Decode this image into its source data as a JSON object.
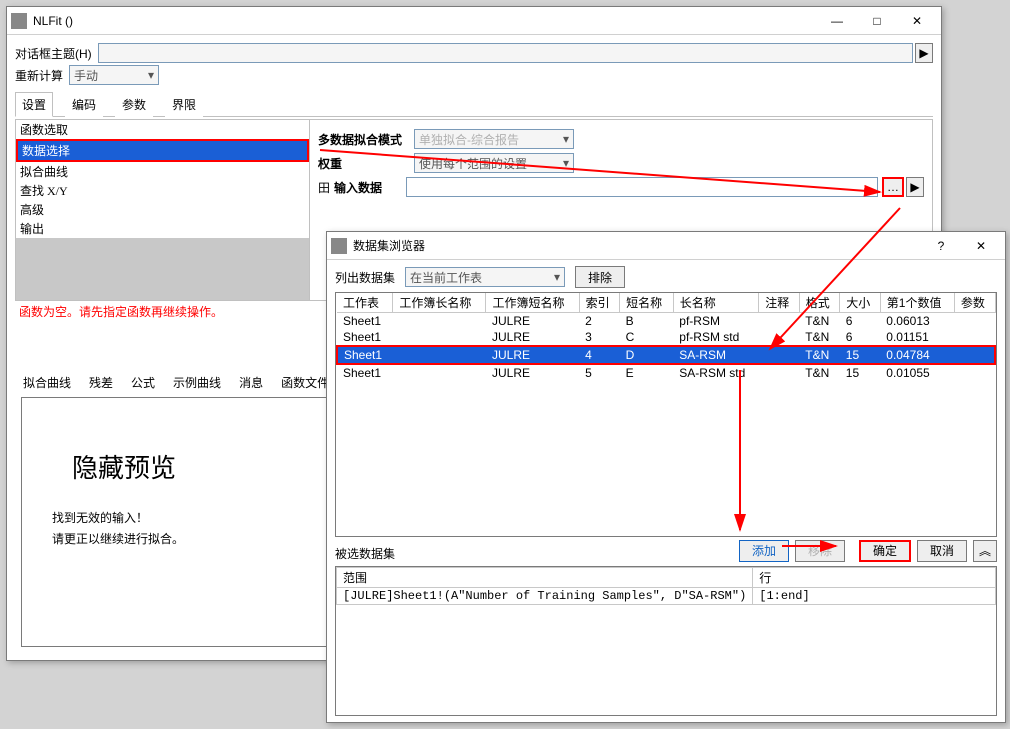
{
  "nlfit": {
    "title": "NLFit ()",
    "dialog_theme_label": "对话框主题(H)",
    "recalc_label": "重新计算",
    "recalc_value": "手动",
    "tabs": [
      "设置",
      "编码",
      "参数",
      "界限"
    ],
    "left_items": [
      "函数选取",
      "数据选择",
      "拟合曲线",
      "查找 X/Y",
      "高级",
      "输出"
    ],
    "left_selected": 1,
    "right": {
      "multi_mode_label": "多数据拟合模式",
      "multi_mode_value": "单独拟合-综合报告",
      "weight_label": "权重",
      "weight_value": "使用每个范围的设置",
      "input_expand_label": "田",
      "input_data_label": "输入数据",
      "dots_label": "…"
    },
    "warning": "函数为空。请先指定函数再继续操作。",
    "lower_tabs": [
      "拟合曲线",
      "残差",
      "公式",
      "示例曲线",
      "消息",
      "函数文件"
    ],
    "preview_title": "隐藏预览",
    "preview_msg_1": "找到无效的输入！",
    "preview_msg_2": "请更正以继续进行拟合。"
  },
  "dsb": {
    "title": "数据集浏览器",
    "help_icon": "?",
    "list_label": "列出数据集",
    "list_value": "在当前工作表",
    "exclude_btn": "排除",
    "columns": [
      "工作表",
      "工作簿长名称",
      "工作簿短名称",
      "索引",
      "短名称",
      "长名称",
      "注释",
      "格式",
      "大小",
      "第1个数值",
      "参数"
    ],
    "rows": [
      {
        "cells": [
          "Sheet1",
          "",
          "JULRE",
          "2",
          "B",
          "pf-RSM",
          "",
          "T&N",
          "6",
          "0.06013",
          ""
        ],
        "sel": false
      },
      {
        "cells": [
          "Sheet1",
          "",
          "JULRE",
          "3",
          "C",
          "pf-RSM std",
          "",
          "T&N",
          "6",
          "0.01151",
          ""
        ],
        "sel": false
      },
      {
        "cells": [
          "Sheet1",
          "",
          "JULRE",
          "4",
          "D",
          "SA-RSM",
          "",
          "T&N",
          "15",
          "0.04784",
          ""
        ],
        "sel": true
      },
      {
        "cells": [
          "Sheet1",
          "",
          "JULRE",
          "5",
          "E",
          "SA-RSM std",
          "",
          "T&N",
          "15",
          "0.01055",
          ""
        ],
        "sel": false
      }
    ],
    "selected_label": "被选数据集",
    "add_btn": "添加",
    "remove_btn": "移除",
    "ok_btn": "确定",
    "cancel_btn": "取消",
    "grid_headers": [
      "范围",
      "行"
    ],
    "grid_row": [
      "[JULRE]Sheet1!(A\"Number of Training Samples\", D\"SA-RSM\")",
      "[1:end]"
    ]
  }
}
